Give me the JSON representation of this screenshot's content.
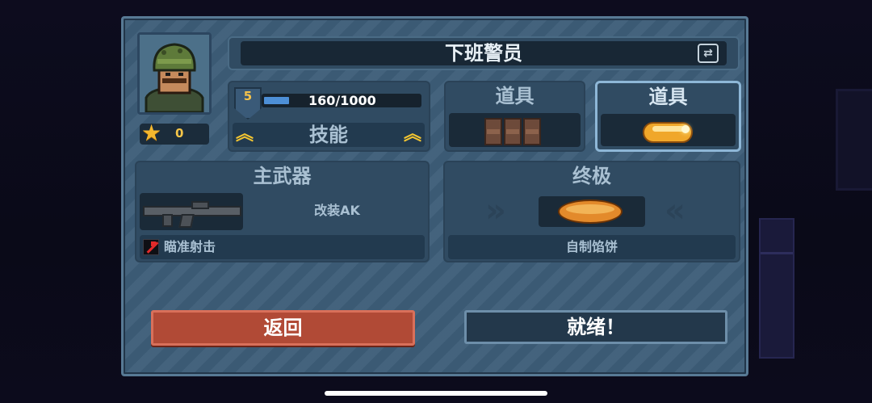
{
  "character": {
    "name": "下班警员",
    "stars": "0",
    "level": "5",
    "xp_text": "160/1000",
    "xp_fraction": 0.16,
    "skill_label": "技能"
  },
  "items": {
    "slot1_label": "道具",
    "slot2_label": "道具"
  },
  "weapon": {
    "section_label": "主武器",
    "name": "改装AK",
    "trait": "瞄准射击"
  },
  "ultimate": {
    "section_label": "终极",
    "name": "自制馅饼"
  },
  "buttons": {
    "back": "返回",
    "ready": "就绪！"
  },
  "colors": {
    "panel": "#3d5d78",
    "back_button": "#b14a36",
    "accent_gold": "#f3c531"
  }
}
